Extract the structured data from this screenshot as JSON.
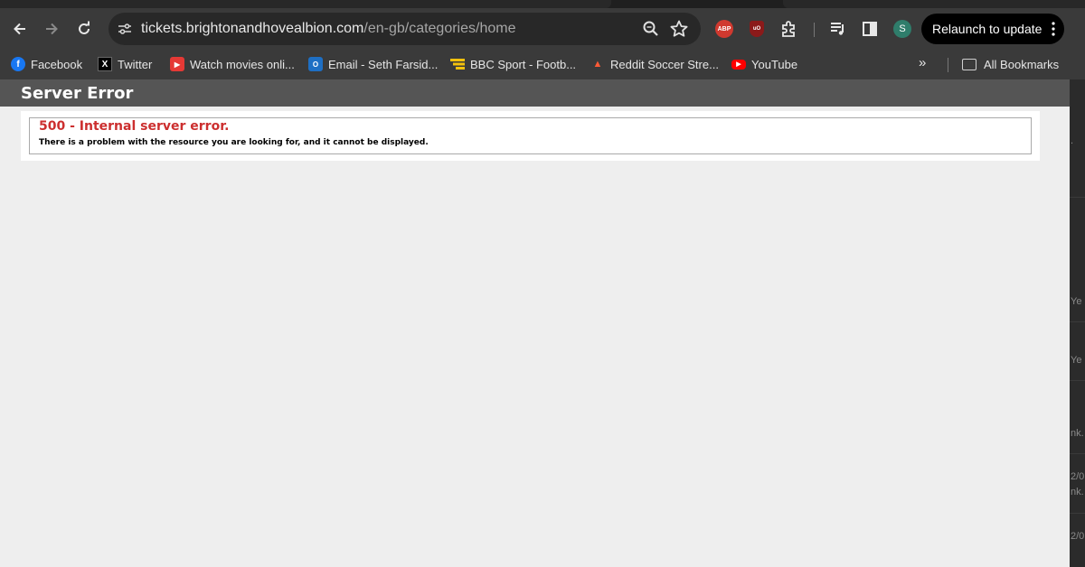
{
  "browser": {
    "url_host": "tickets.brightonandhovealbion.com",
    "url_path": "/en-gb/categories/home",
    "relaunch_label": "Relaunch to update",
    "avatar_initial": "S",
    "extensions": {
      "abp_label": "ABP",
      "ublock_label": "uO"
    },
    "icons": [
      "back-icon",
      "forward-icon",
      "reload-icon",
      "site-info-icon",
      "zoom-icon",
      "star-icon",
      "puzzle-icon",
      "media-icon",
      "side-panel-icon",
      "more-vert-icon"
    ]
  },
  "bookmarks": {
    "items": [
      {
        "label": "Facebook",
        "icon": "facebook-icon"
      },
      {
        "label": "Twitter",
        "icon": "x-icon"
      },
      {
        "label": "Watch movies onli...",
        "icon": "play-icon"
      },
      {
        "label": "Email - Seth Farsid...",
        "icon": "outlook-icon"
      },
      {
        "label": "BBC Sport - Footb...",
        "icon": "bbc-sport-icon"
      },
      {
        "label": "Reddit Soccer Stre...",
        "icon": "reddit-icon"
      },
      {
        "label": "YouTube",
        "icon": "youtube-icon"
      }
    ],
    "overflow_label": "»",
    "all_label": "All Bookmarks"
  },
  "page": {
    "header_title": "Server Error",
    "error_title": "500 - Internal server error.",
    "error_description": "There is a problem with the resource you are looking for, and it cannot be displayed.",
    "colors": {
      "header_bg": "#555555",
      "error_title": "#cc2f2f",
      "page_bg": "#eeeeee"
    }
  },
  "background_window": {
    "fragments": [
      ".",
      "Ye",
      "Ye",
      "nk.",
      "2/0",
      "nk.",
      "2/0"
    ]
  }
}
